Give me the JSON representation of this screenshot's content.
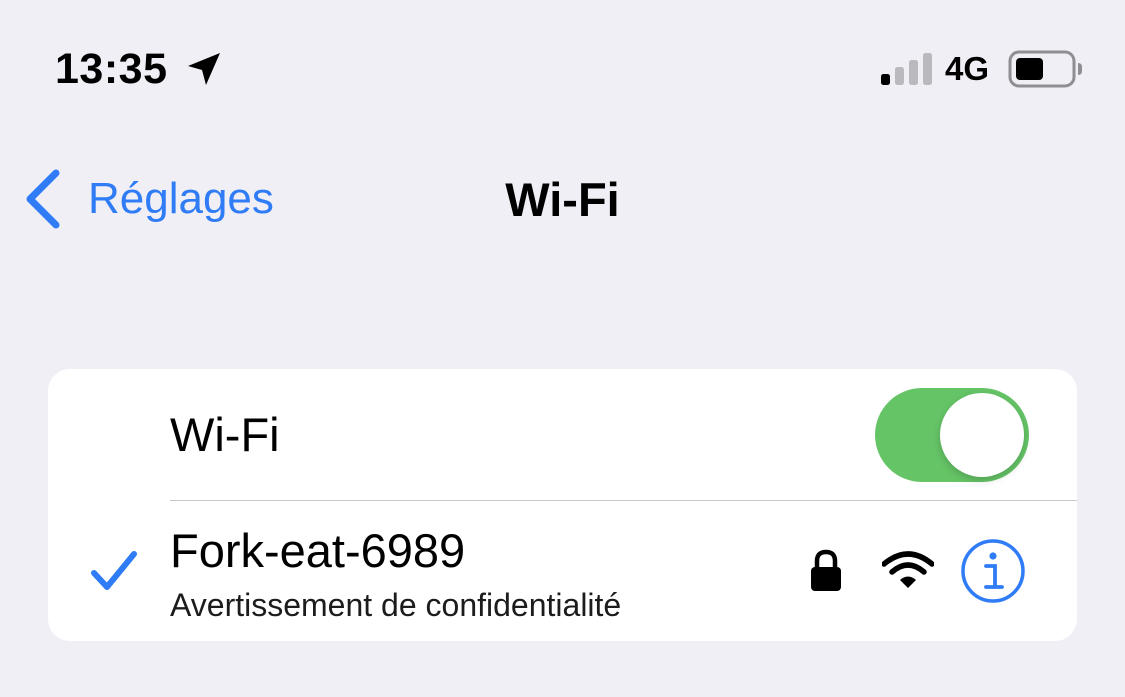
{
  "status_bar": {
    "time": "13:35",
    "location_icon": "location-arrow-icon",
    "signal_icon": "cellular-signal-icon",
    "signal_bars": 1,
    "signal_bars_total": 4,
    "network_type": "4G",
    "battery_icon": "battery-icon",
    "battery_level": 0.4
  },
  "nav": {
    "back_icon": "chevron-left-icon",
    "back_label": "Réglages",
    "title": "Wi-Fi"
  },
  "wifi_section": {
    "toggle_label": "Wi-Fi",
    "toggle_on": true,
    "toggle_color": "#65c466"
  },
  "connected_network": {
    "selected_icon": "checkmark-icon",
    "name": "Fork-eat-6989",
    "subtitle": "Avertissement de confidentialité",
    "secured_icon": "lock-icon",
    "signal_icon": "wifi-signal-icon",
    "info_icon": "info-icon"
  },
  "colors": {
    "accent": "#2f7cf6",
    "background": "#f0eff5",
    "card": "#ffffff",
    "toggle_on": "#65c466"
  }
}
